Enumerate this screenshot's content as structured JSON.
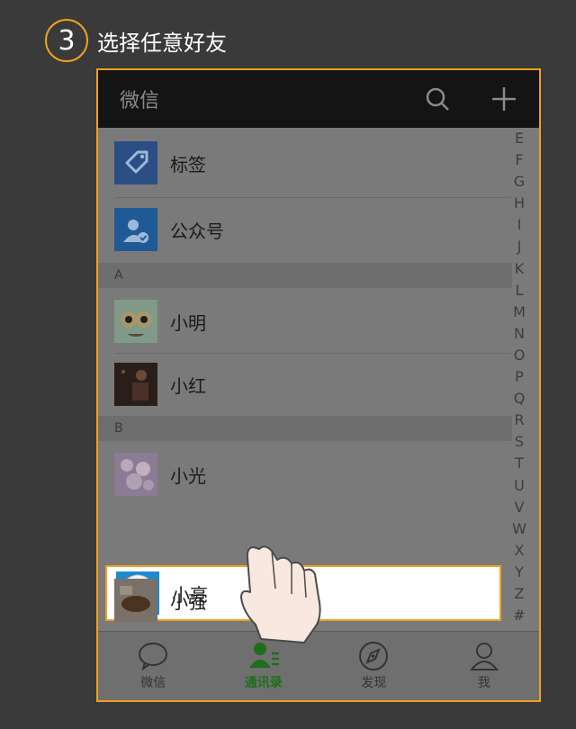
{
  "step": {
    "number": "3",
    "instruction": "选择任意好友"
  },
  "topbar": {
    "title": "微信",
    "search_icon": "search-icon",
    "add_icon": "plus-icon"
  },
  "contacts": {
    "tags_label": "标签",
    "official_label": "公众号",
    "section_a": "A",
    "section_b": "B",
    "items": [
      {
        "name": "小明",
        "avatar": "avatar-cartoon"
      },
      {
        "name": "小红",
        "avatar": "avatar-dark"
      },
      {
        "name": "小光",
        "avatar": "avatar-flowers"
      },
      {
        "name": "小亮",
        "avatar": "avatar-anime"
      },
      {
        "name": "小强",
        "avatar": "avatar-brown"
      }
    ]
  },
  "alphabet_index": [
    "E",
    "F",
    "G",
    "H",
    "I",
    "J",
    "K",
    "L",
    "M",
    "N",
    "O",
    "P",
    "Q",
    "R",
    "S",
    "T",
    "U",
    "V",
    "W",
    "X",
    "Y",
    "Z",
    "#"
  ],
  "tabbar": {
    "tabs": [
      {
        "label": "微信",
        "icon": "chat-bubble-icon"
      },
      {
        "label": "通讯录",
        "icon": "contacts-icon",
        "active": true
      },
      {
        "label": "发现",
        "icon": "compass-icon"
      },
      {
        "label": "我",
        "icon": "person-icon"
      }
    ]
  },
  "colors": {
    "highlight_border": "#f0a020",
    "active_tab": "#1f6e1a",
    "tag_icon_bg": "#2b62a8"
  }
}
